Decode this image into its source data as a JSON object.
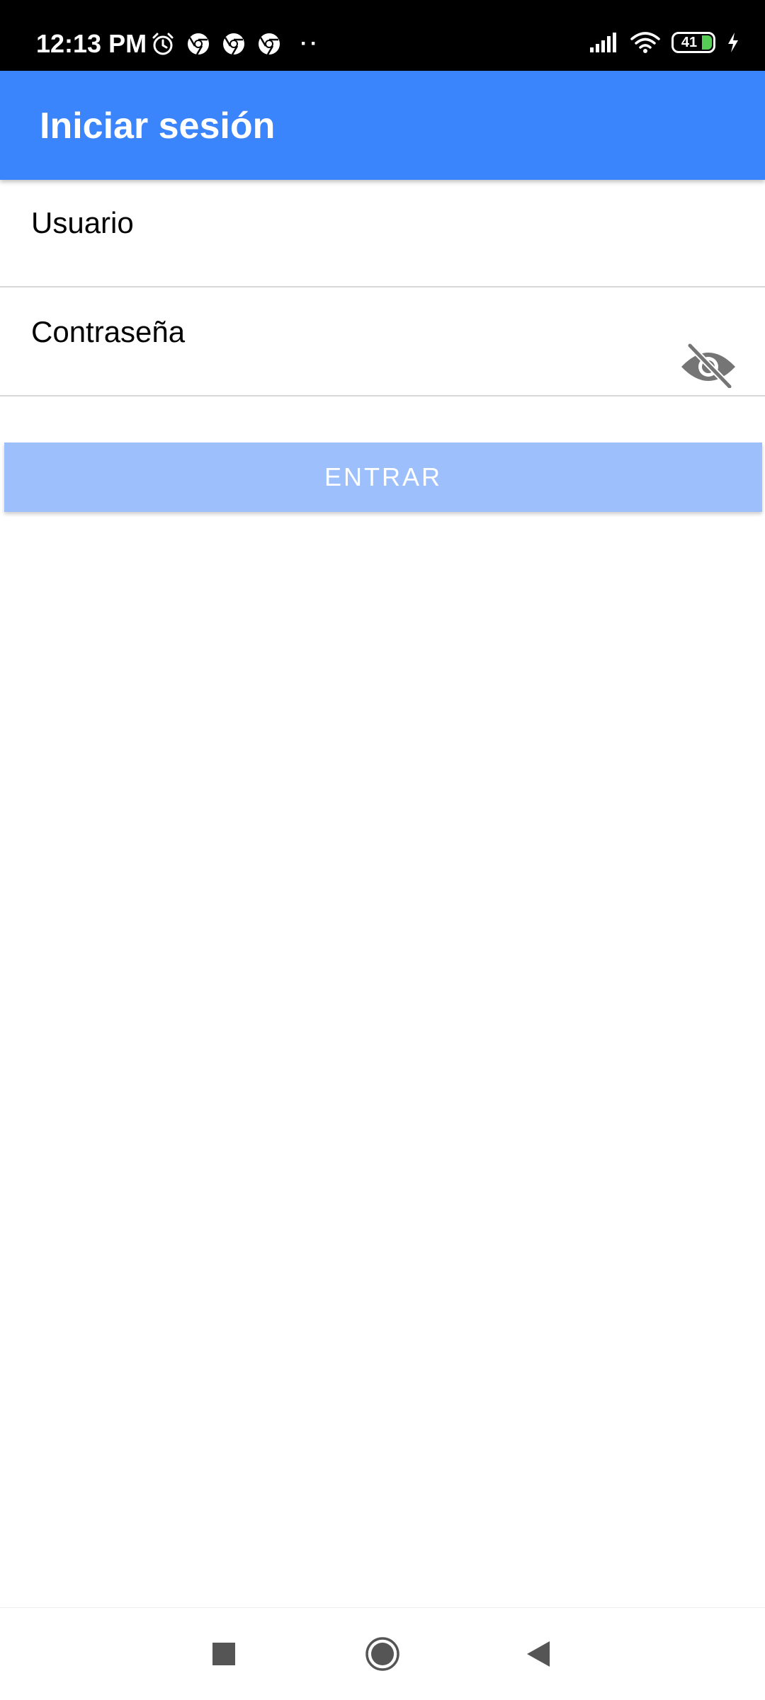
{
  "status_bar": {
    "time": "12:13 PM",
    "left_icons": [
      "alarm-icon",
      "chrome-icon",
      "chrome-icon",
      "chrome-icon"
    ],
    "overflow": "··",
    "battery_level": "41",
    "right_icons": [
      "signal-icon",
      "wifi-icon",
      "battery-icon",
      "charging-icon"
    ]
  },
  "app_bar": {
    "title": "Iniciar sesión",
    "color": "#3a84fc"
  },
  "form": {
    "username": {
      "placeholder": "Usuario",
      "value": ""
    },
    "password": {
      "placeholder": "Contraseña",
      "value": "",
      "toggle_icon": "eye-off-icon"
    },
    "submit": {
      "label": "ENTRAR",
      "enabled": false,
      "color": "#9dc0fd"
    }
  },
  "nav_bar": {
    "buttons": [
      "recents-icon",
      "home-icon",
      "back-icon"
    ]
  }
}
